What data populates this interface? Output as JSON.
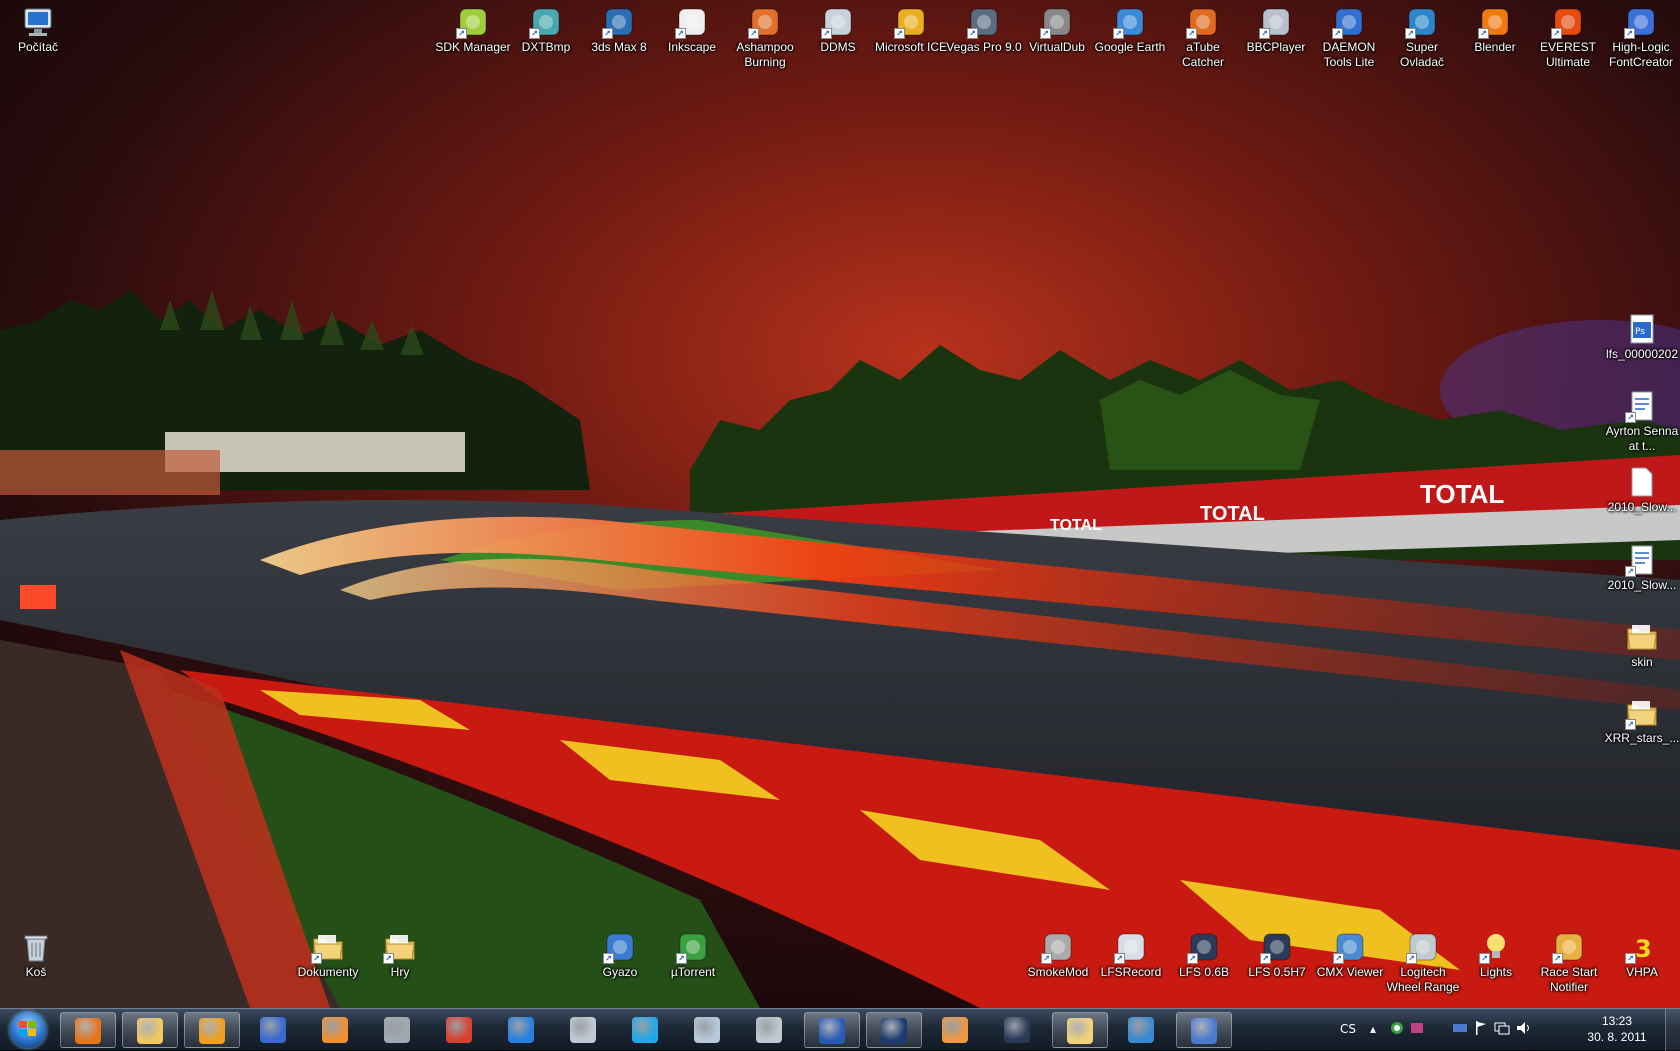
{
  "desktop": {
    "top_icons": [
      {
        "label": "SDK Manager",
        "icon": "android-icon",
        "color": "#9fce3a"
      },
      {
        "label": "DXTBmp",
        "icon": "dxtbmp-icon",
        "color": "#48a8b0"
      },
      {
        "label": "3ds Max 8",
        "icon": "3dsmax-icon",
        "color": "#2a6fb4"
      },
      {
        "label": "Inkscape",
        "icon": "inkscape-icon",
        "color": "#eeeeee"
      },
      {
        "label": "Ashampoo Burning",
        "icon": "ashampoo-icon",
        "color": "#e0702a"
      },
      {
        "label": "DDMS",
        "icon": "ddms-icon",
        "color": "#c8d2dc"
      },
      {
        "label": "Microsoft ICE",
        "icon": "ice-icon",
        "color": "#e8b020"
      },
      {
        "label": "Vegas Pro 9.0",
        "icon": "vegas-icon",
        "color": "#5a6c80"
      },
      {
        "label": "VirtualDub",
        "icon": "virtualdub-icon",
        "color": "#888888"
      },
      {
        "label": "Google Earth",
        "icon": "google-earth-icon",
        "color": "#3a8ad8"
      },
      {
        "label": "aTube Catcher",
        "icon": "atube-icon",
        "color": "#e06a20"
      },
      {
        "label": "BBCPlayer",
        "icon": "bbcplayer-icon",
        "color": "#b8c0cc"
      },
      {
        "label": "DAEMON Tools Lite",
        "icon": "daemon-tools-icon",
        "color": "#3070d0"
      },
      {
        "label": "Super Ovladač",
        "icon": "super-ovladac-icon",
        "color": "#2a86c8"
      },
      {
        "label": "Blender",
        "icon": "blender-icon",
        "color": "#f07a10"
      },
      {
        "label": "EVEREST Ultimate",
        "icon": "everest-icon",
        "color": "#e84a10"
      },
      {
        "label": "High-Logic FontCreator",
        "icon": "fontcreator-icon",
        "color": "#3a70d8"
      }
    ],
    "computer_icon": {
      "label": "Počítač",
      "icon": "computer-icon"
    },
    "right_icons": [
      {
        "label": "lfs_00000202",
        "icon": "psd-file-icon",
        "color": "#2a6ad0"
      },
      {
        "label": "Ayrton Senna at t...",
        "icon": "document-icon",
        "color": "#5a8ad8"
      },
      {
        "label": "2010_Slow...",
        "icon": "blank-file-icon",
        "color": "#ffffff"
      },
      {
        "label": "2010_Slow...",
        "icon": "document-icon",
        "color": "#5a8ad8"
      },
      {
        "label": "skin",
        "icon": "folder-icon",
        "color": "#f2d27a"
      },
      {
        "label": "XRR_stars_...",
        "icon": "folder-shortcut-icon",
        "color": "#f2d27a"
      }
    ],
    "bottom_left_icons": [
      {
        "label": "Koš",
        "icon": "recycle-bin-icon",
        "color": "#c8d0d8"
      },
      {
        "label": "Dokumenty",
        "icon": "folder-shortcut-icon",
        "color": "#f2d27a"
      },
      {
        "label": "Hry",
        "icon": "folder-shortcut-icon",
        "color": "#f2d27a"
      },
      {
        "label": "Gyazo",
        "icon": "gyazo-icon",
        "color": "#3a7ad0"
      },
      {
        "label": "µTorrent",
        "icon": "utorrent-icon",
        "color": "#3aa040"
      }
    ],
    "bottom_right_icons": [
      {
        "label": "SmokeMod",
        "icon": "smokemod-icon",
        "color": "#aaaaaa"
      },
      {
        "label": "LFSRecord",
        "icon": "lfsrecord-icon",
        "color": "#d8dce4"
      },
      {
        "label": "LFS 0.6B",
        "icon": "lfs-icon",
        "color": "#2a3a58"
      },
      {
        "label": "LFS 0.5H7",
        "icon": "lfs-icon",
        "color": "#2a3a58"
      },
      {
        "label": "CMX Viewer",
        "icon": "cmx-viewer-icon",
        "color": "#4a8ad0"
      },
      {
        "label": "Logitech Wheel Range",
        "icon": "gamepad-icon",
        "color": "#c0c8d0"
      },
      {
        "label": "Lights",
        "icon": "lightbulb-icon",
        "color": "#f8e070"
      },
      {
        "label": "Race Start Notifier",
        "icon": "bell-icon",
        "color": "#e8b040"
      },
      {
        "label": "VHPA",
        "icon": "vhpa-icon",
        "color": "#f8d820"
      }
    ]
  },
  "wallpaper": {
    "banner_text": "TOTAL"
  },
  "taskbar": {
    "pinned": [
      {
        "name": "firefox",
        "icon": "firefox-icon",
        "color": "#e8741a",
        "active": true
      },
      {
        "name": "explorer",
        "icon": "explorer-folder-icon",
        "color": "#f0c860",
        "active": true
      },
      {
        "name": "winamp",
        "icon": "winamp-icon",
        "color": "#f0a020",
        "active": true
      },
      {
        "name": "media-center",
        "icon": "media-icon",
        "color": "#3a6ad0",
        "active": false
      },
      {
        "name": "media-player",
        "icon": "media-player-icon",
        "color": "#f09030",
        "active": false
      },
      {
        "name": "amd",
        "icon": "amd-icon",
        "color": "#a0a8b0",
        "active": false
      },
      {
        "name": "chrome",
        "icon": "chrome-icon",
        "color": "#d84030",
        "active": false
      },
      {
        "name": "internet-explorer",
        "icon": "ie-icon",
        "color": "#2a80e0",
        "active": false
      },
      {
        "name": "steam",
        "icon": "steam-icon",
        "color": "#c0c8d0",
        "active": false
      },
      {
        "name": "skype",
        "icon": "skype-icon",
        "color": "#20a8e8",
        "active": false
      },
      {
        "name": "calculator",
        "icon": "calculator-icon",
        "color": "#b8c8d8",
        "active": false
      },
      {
        "name": "usb-tool",
        "icon": "usb-icon",
        "color": "#c0c8d0",
        "active": false
      },
      {
        "name": "floppy-app",
        "icon": "floppy-icon",
        "color": "#2a5ab8",
        "active": true
      },
      {
        "name": "photoshop",
        "icon": "photoshop-icon",
        "color": "#1a3a70",
        "active": true
      },
      {
        "name": "image-viewer",
        "icon": "image-viewer-icon",
        "color": "#f09840",
        "active": false
      },
      {
        "name": "lfs",
        "icon": "lfs-icon",
        "color": "#2a3a58",
        "active": false
      },
      {
        "name": "folder-window",
        "icon": "folder-icon",
        "color": "#f2d27a",
        "active": true
      },
      {
        "name": "network-app",
        "icon": "globe-icon",
        "color": "#3a8ad0",
        "active": false
      },
      {
        "name": "editor-app",
        "icon": "editor-icon",
        "color": "#4a7ad0",
        "active": true
      }
    ],
    "tray": {
      "language": "CS",
      "time": "13:23",
      "date": "30. 8. 2011"
    }
  }
}
